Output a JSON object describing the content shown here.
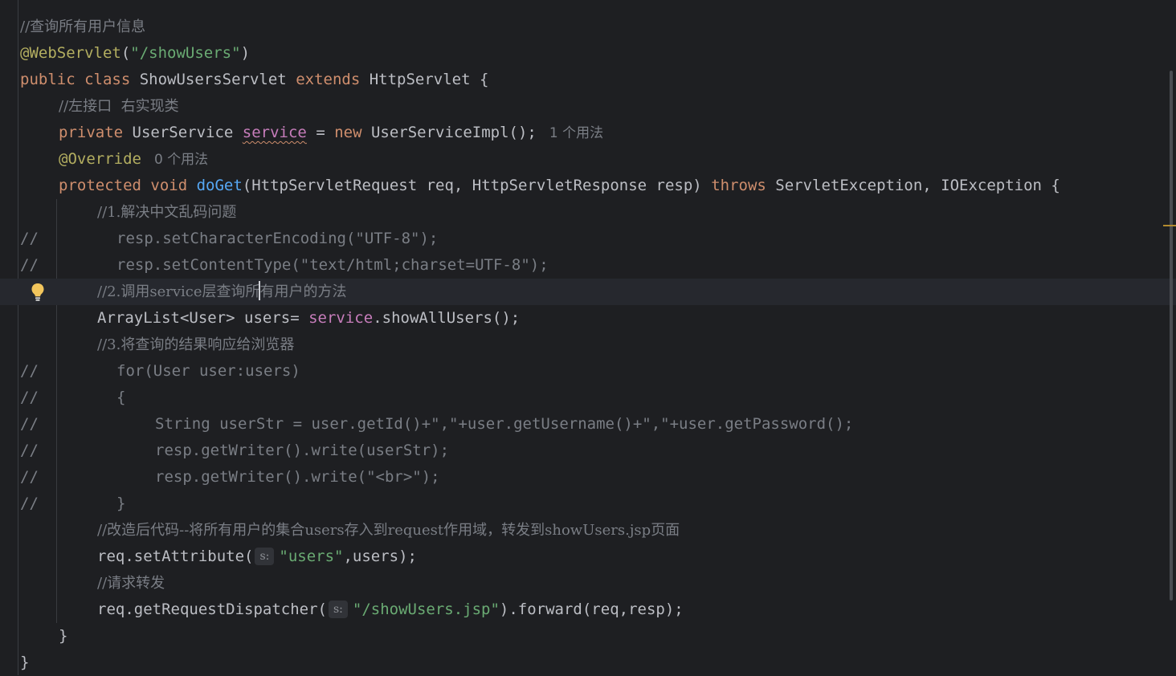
{
  "colors": {
    "background": "#1e1f22",
    "text": "#bcbec4",
    "keyword": "#cf8e6d",
    "string": "#6aab73",
    "annotation": "#b3ae60",
    "field": "#c77dbb",
    "function": "#56a8f5",
    "comment": "#7a7e85",
    "bulb": "#f2c55c"
  },
  "icons": {
    "gutter": "lightbulb-icon"
  },
  "lines": [
    {
      "prefix": "",
      "tokens": [
        {
          "t": "//",
          "c": "cmt"
        },
        {
          "t": "查询所有用户信息",
          "c": "cmt"
        }
      ]
    },
    {
      "prefix": "",
      "tokens": [
        {
          "t": "@WebServlet",
          "c": "ann"
        },
        {
          "t": "(",
          "c": ""
        },
        {
          "t": "\"/showUsers\"",
          "c": "str"
        },
        {
          "t": ")",
          "c": ""
        }
      ]
    },
    {
      "prefix": "",
      "tokens": [
        {
          "t": "public class ",
          "c": "kw"
        },
        {
          "t": "ShowUsersServlet ",
          "c": ""
        },
        {
          "t": "extends ",
          "c": "kw"
        },
        {
          "t": "HttpServlet {",
          "c": ""
        }
      ]
    },
    {
      "prefix": "",
      "tokens": [
        {
          "t": "//",
          "c": "cmt"
        },
        {
          "t": "左接口  右实现类",
          "c": "cmt"
        }
      ]
    },
    {
      "prefix": "",
      "tokens": [
        {
          "t": "private ",
          "c": "kw"
        },
        {
          "t": "UserService ",
          "c": ""
        },
        {
          "t": "service",
          "c": "field squiggle"
        },
        {
          "t": " = ",
          "c": ""
        },
        {
          "t": "new ",
          "c": "kw"
        },
        {
          "t": "UserServiceImpl();",
          "c": ""
        },
        {
          "t": "1 个用法",
          "c": "hint"
        }
      ]
    },
    {
      "prefix": "",
      "tokens": [
        {
          "t": "@Override",
          "c": "ann"
        },
        {
          "t": "0 个用法",
          "c": "hint"
        }
      ]
    },
    {
      "prefix": "",
      "tokens": [
        {
          "t": "protected void ",
          "c": "kw"
        },
        {
          "t": "doGet",
          "c": "fn"
        },
        {
          "t": "(HttpServletRequest req, HttpServletResponse resp) ",
          "c": ""
        },
        {
          "t": "throws ",
          "c": "kw"
        },
        {
          "t": "ServletException, IOException {",
          "c": ""
        }
      ]
    },
    {
      "prefix": "",
      "tokens": [
        {
          "t": "//",
          "c": "cmt"
        },
        {
          "t": "1.",
          "c": "cmt"
        },
        {
          "t": "解决中文乱码问题",
          "c": "cmt"
        }
      ]
    },
    {
      "prefix": "//",
      "tokens": [
        {
          "t": "resp.setCharacterEncoding(\"UTF-8\");",
          "c": "dim"
        }
      ]
    },
    {
      "prefix": "//",
      "tokens": [
        {
          "t": "resp.setContentType(\"text/html;charset=UTF-8\");",
          "c": "dim"
        }
      ]
    },
    {
      "prefix": "",
      "tokens": [
        {
          "t": "//",
          "c": "cmt"
        },
        {
          "t": "2.",
          "c": "cmt"
        },
        {
          "t": "调用",
          "c": "cmt"
        },
        {
          "t": "service",
          "c": "cmt"
        },
        {
          "t": "层查询所",
          "c": "cmt"
        },
        {
          "t": "有用户的方法",
          "c": "cmt"
        }
      ]
    },
    {
      "prefix": "",
      "tokens": [
        {
          "t": "ArrayList<User> users= ",
          "c": ""
        },
        {
          "t": "service",
          "c": "field"
        },
        {
          "t": ".showAllUsers();",
          "c": ""
        }
      ]
    },
    {
      "prefix": "",
      "tokens": [
        {
          "t": "//",
          "c": "cmt"
        },
        {
          "t": "3.",
          "c": "cmt"
        },
        {
          "t": "将查询的结果响应给浏览器",
          "c": "cmt"
        }
      ]
    },
    {
      "prefix": "//",
      "tokens": [
        {
          "t": "for(User user:users)",
          "c": "dim"
        }
      ]
    },
    {
      "prefix": "//",
      "tokens": [
        {
          "t": "{",
          "c": "dim"
        }
      ]
    },
    {
      "prefix": "//",
      "tokens": [
        {
          "t": "String userStr = user.getId()+\",\"+user.getUsername()+\",\"+user.getPassword();",
          "c": "dim"
        }
      ]
    },
    {
      "prefix": "//",
      "tokens": [
        {
          "t": "resp.getWriter().write(userStr);",
          "c": "dim"
        }
      ]
    },
    {
      "prefix": "//",
      "tokens": [
        {
          "t": "resp.getWriter().write(\"<br>\");",
          "c": "dim"
        }
      ]
    },
    {
      "prefix": "//",
      "tokens": [
        {
          "t": "}",
          "c": "dim"
        }
      ]
    },
    {
      "prefix": "",
      "tokens": [
        {
          "t": "//",
          "c": "cmt"
        },
        {
          "t": "改造后代码--将所有用户的集合",
          "c": "cmt"
        },
        {
          "t": "users",
          "c": "cmt"
        },
        {
          "t": "存入到",
          "c": "cmt"
        },
        {
          "t": "request",
          "c": "cmt"
        },
        {
          "t": "作用域，转发到",
          "c": "cmt"
        },
        {
          "t": "showUsers.jsp",
          "c": "cmt"
        },
        {
          "t": "页面",
          "c": "cmt"
        }
      ]
    },
    {
      "prefix": "",
      "tokens": [
        {
          "t": "req.setAttribute(",
          "c": ""
        },
        {
          "t": "s:",
          "c": "param"
        },
        {
          "t": "\"users\"",
          "c": "str"
        },
        {
          "t": ",users);",
          "c": ""
        }
      ]
    },
    {
      "prefix": "",
      "tokens": [
        {
          "t": "//",
          "c": "cmt"
        },
        {
          "t": "请求转发",
          "c": "cmt"
        }
      ]
    },
    {
      "prefix": "",
      "tokens": [
        {
          "t": "req.getRequestDispatcher(",
          "c": ""
        },
        {
          "t": "s:",
          "c": "param"
        },
        {
          "t": "\"/showUsers.jsp\"",
          "c": "str"
        },
        {
          "t": ").forward(req,resp);",
          "c": ""
        }
      ]
    },
    {
      "prefix": "",
      "tokens": [
        {
          "t": "}",
          "c": ""
        }
      ]
    },
    {
      "prefix": "",
      "tokens": [
        {
          "t": "}",
          "c": ""
        }
      ]
    }
  ]
}
